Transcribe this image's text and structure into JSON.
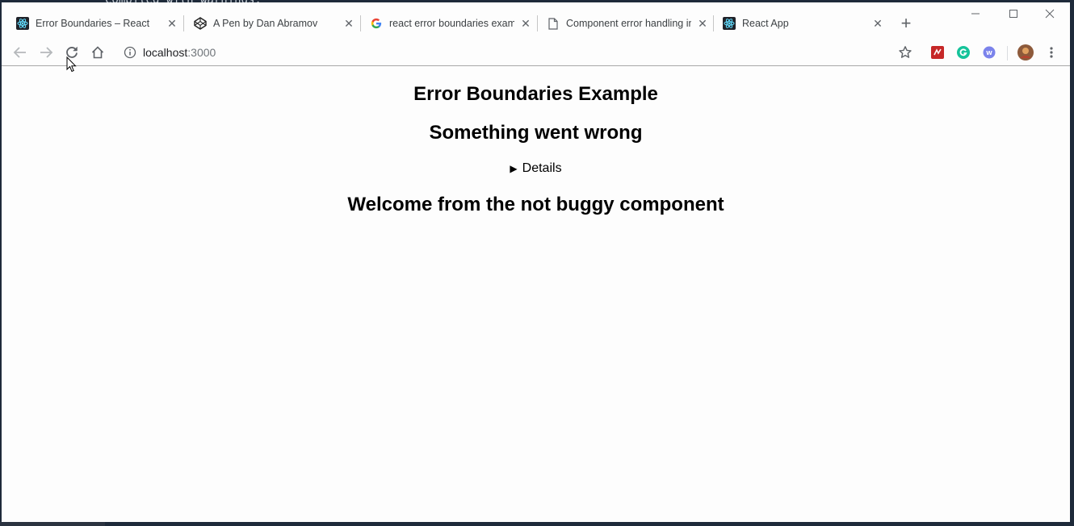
{
  "tabs": [
    {
      "title": "Error Boundaries – React",
      "icon": "react-icon"
    },
    {
      "title": "A Pen by Dan Abramov",
      "icon": "codepen-icon"
    },
    {
      "title": "react error boundaries examp",
      "icon": "google-icon"
    },
    {
      "title": "Component error handling in",
      "icon": "document-icon"
    },
    {
      "title": "React App",
      "icon": "react-icon",
      "active": true
    }
  ],
  "address": {
    "host": "localhost",
    "port": ":3000"
  },
  "page": {
    "heading": "Error Boundaries Example",
    "error_message": "Something went wrong",
    "details_label": "Details",
    "welcome": "Welcome from the not buggy component"
  },
  "background": {
    "terminal_text": "Compiled with warnings."
  },
  "colors": {
    "react": "#61dafb",
    "react_bg": "#20232a",
    "accent": "#1a73e8"
  }
}
